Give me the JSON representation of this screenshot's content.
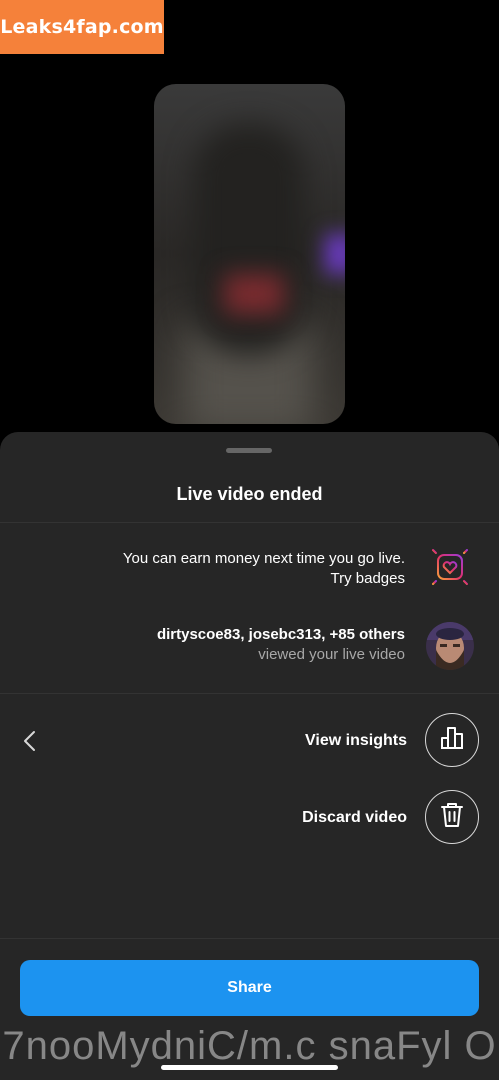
{
  "watermark_top": "Leaks4fap.com",
  "watermark_bottom": "7nooMydniC/m.c snaFyl O",
  "sheet": {
    "title": "Live video ended",
    "badges_row": {
      "line1": "You can earn money next time you go live.",
      "line2": "Try badges",
      "icon": "badge-gift-icon"
    },
    "viewers_row": {
      "line1": "dirtyscoe83, josebc313, +85 others",
      "line2": "viewed your live video",
      "icon": "viewer-avatar"
    },
    "actions": [
      {
        "label": "View insights",
        "icon": "bar-chart-icon"
      },
      {
        "label": "Discard video",
        "icon": "trash-icon"
      }
    ],
    "share_label": "Share"
  },
  "colors": {
    "sheet_bg": "#262626",
    "share_button": "#1c93f0",
    "watermark": "#f5813a"
  }
}
